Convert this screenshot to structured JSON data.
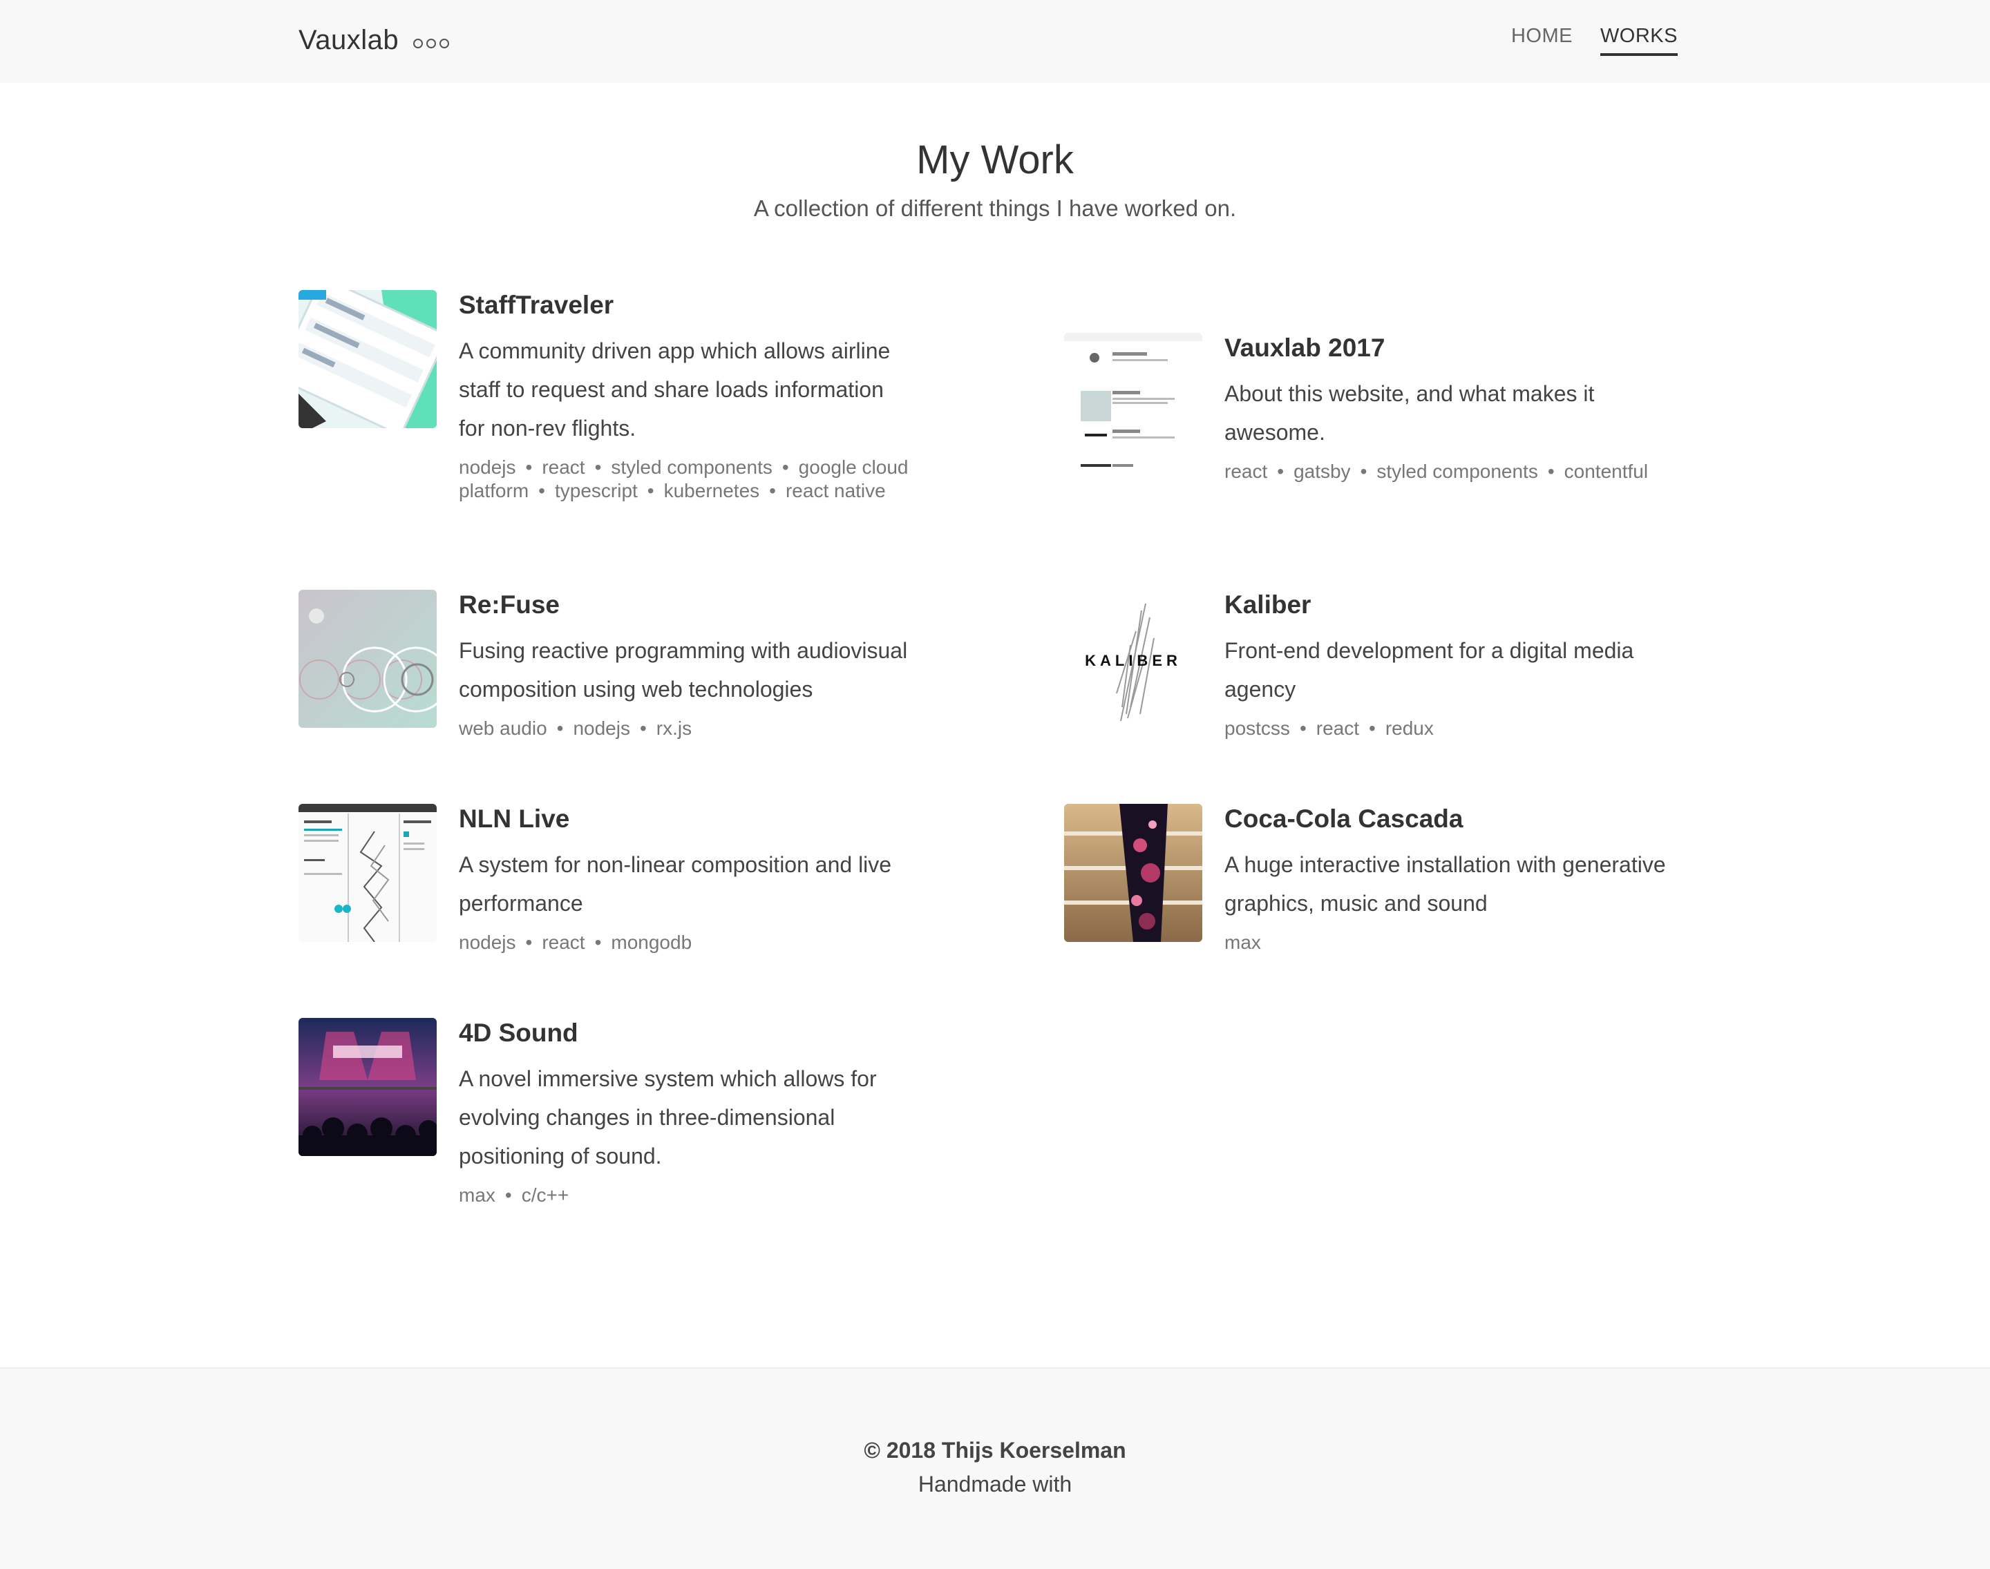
{
  "nav": {
    "brand": "Vauxlab",
    "links": [
      "HOME",
      "WORKS"
    ]
  },
  "page": {
    "title": "My Work",
    "subtitle": "A collection of different things I have worked on."
  },
  "works": [
    {
      "title": "StaffTraveler",
      "description": "A community driven app which allows airline staff to request and share loads information for non-rev flights.",
      "tags": [
        "nodejs",
        "react",
        "styled components",
        "google cloud platform",
        "typescript",
        "kubernetes",
        "react native"
      ]
    },
    {
      "title": "Vauxlab 2017",
      "description": "About this website, and what makes it awesome.",
      "tags": [
        "react",
        "gatsby",
        "styled components",
        "contentful"
      ]
    },
    {
      "title": "Re:Fuse",
      "description": "Fusing reactive programming with audiovisual composition using web technologies",
      "tags": [
        "web audio",
        "nodejs",
        "rx.js"
      ]
    },
    {
      "title": "Kaliber",
      "description": "Front-end development for a digital media agency",
      "tags": [
        "postcss",
        "react",
        "redux"
      ],
      "logo_text": "KALIBER"
    },
    {
      "title": "NLN Live",
      "description": "A system for non-linear composition and live performance",
      "tags": [
        "nodejs",
        "react",
        "mongodb"
      ]
    },
    {
      "title": "Coca-Cola Cascada",
      "description": "A huge interactive installation with generative graphics, music and sound",
      "tags": [
        "max"
      ]
    },
    {
      "title": "4D Sound",
      "description": "A novel immersive system which allows for evolving changes in three-dimensional positioning of sound.",
      "tags": [
        "max",
        "c/c++"
      ]
    }
  ],
  "footer": {
    "copyright": "© 2018 Thijs Koerselman",
    "tagline": "Handmade with"
  }
}
